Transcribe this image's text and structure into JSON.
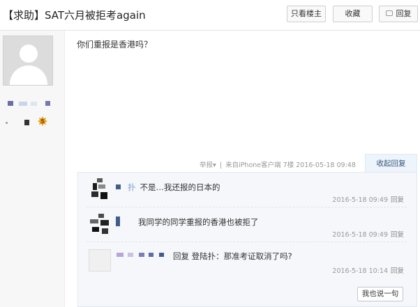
{
  "header": {
    "title": "【求助】SAT六月被拒考again",
    "buttons": {
      "only_host": "只看楼主",
      "favorite": "收藏",
      "reply": "回复"
    }
  },
  "sidebar": {
    "badge_number": "5"
  },
  "post": {
    "content": "你们重报是香港吗？",
    "meta": {
      "report": "举报",
      "report_caret": "▾",
      "separator": "|",
      "source": "来自iPhone客户端",
      "floor": "7楼",
      "time": "2016-05-18 09:48"
    },
    "reply_button": "收起回复"
  },
  "replies": [
    {
      "text_prefix": "扑",
      "text": "不是…我还报的日本的",
      "time": "2016-5-18 09:49",
      "reply_label": "回复"
    },
    {
      "text": "我同学的同学重报的香港也被拒了",
      "time": "2016-5-18 09:49",
      "reply_label": "回复"
    },
    {
      "text": "回复 登陆扑：那准考证取消了吗?",
      "time": "2016-5-18 10:14",
      "reply_label": "回复"
    }
  ],
  "say_button": "我也说一句"
}
